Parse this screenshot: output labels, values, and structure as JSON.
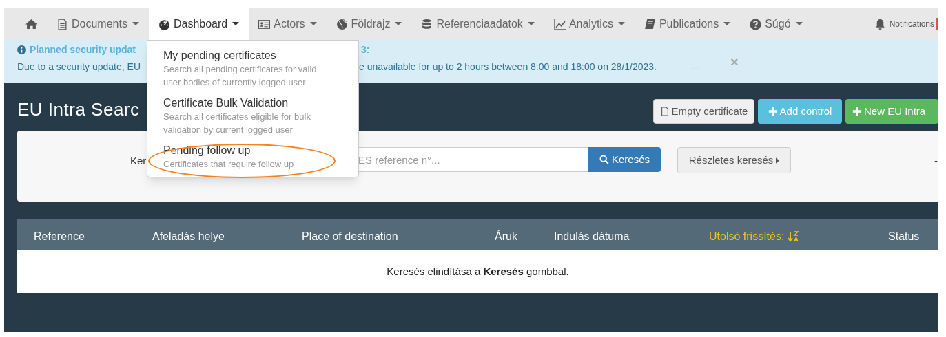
{
  "nav": {
    "items": [
      {
        "selected": false
      },
      {
        "label": "Documents",
        "selected": false
      },
      {
        "label": "Dashboard",
        "selected": true
      },
      {
        "label": "Actors",
        "selected": false
      },
      {
        "label": "Földrajz",
        "selected": false
      },
      {
        "label": "Referenciaadatok",
        "selected": false
      },
      {
        "label": "Analytics",
        "selected": false
      },
      {
        "label": "Publications",
        "selected": false
      },
      {
        "label": "Súgó",
        "selected": false
      }
    ],
    "notifications": "Notifications"
  },
  "dropdown": {
    "items": [
      {
        "title": "My pending certificates",
        "description": "Search all pending certificates for valid user bodies of currently logged user",
        "highlighted": false
      },
      {
        "title": "Certificate Bulk Validation",
        "description": "Search all certificates eligible for bulk validation by current logged user",
        "highlighted": false
      },
      {
        "title": "Pending follow up",
        "description": "Certificates that require follow up",
        "highlighted": true
      }
    ]
  },
  "alert": {
    "title_start": "Planned security updat",
    "title_end": "3:",
    "text_start": "Due to a security update, EU",
    "text_end": "e unavailable for up to 2 hours between 8:00 and 18:00 on 28/1/2023.",
    "more": "...",
    "close": "×"
  },
  "page_title": "EU Intra Searc",
  "actions": [
    "Empty certificate",
    "Add control",
    "New EU Intra"
  ],
  "search": {
    "label": "Ker",
    "placeholder": "ES reference n°...",
    "button": "Keresés",
    "advanced": "Részletes keresés",
    "trailing": "-"
  },
  "table": {
    "columns": [
      {
        "label": "Reference",
        "sorted": false
      },
      {
        "label": "Afeladás helye",
        "sorted": false
      },
      {
        "label": "Place of destination",
        "sorted": false
      },
      {
        "label": "Áruk",
        "sorted": false
      },
      {
        "label": "Indulás dátuma",
        "sorted": false
      },
      {
        "label": "Utolsó frissítés:",
        "sorted": true
      },
      {
        "label": "Status",
        "sorted": false
      }
    ],
    "empty_message": "Keresés elindítása a **Keresés** gombbal."
  }
}
